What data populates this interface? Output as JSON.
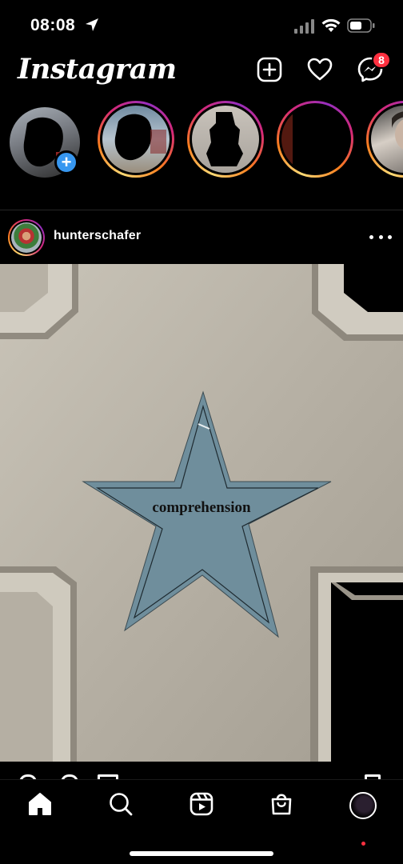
{
  "status_bar": {
    "time": "08:08",
    "icons": [
      "location-arrow-icon",
      "cellular-signal-icon",
      "wifi-icon",
      "battery-icon"
    ]
  },
  "header": {
    "app_name": "Instagram",
    "buttons": [
      "new-post-icon",
      "heart-icon",
      "messenger-icon"
    ],
    "messenger_badge": "8"
  },
  "stories": {
    "items": [
      {
        "kind": "your-story",
        "has_add_badge": true
      },
      {
        "kind": "story",
        "seen": false
      },
      {
        "kind": "story",
        "seen": false
      },
      {
        "kind": "story",
        "seen": false
      },
      {
        "kind": "story",
        "seen": false
      }
    ]
  },
  "post": {
    "username": "hunterschafer",
    "image_text": "comprehension",
    "menu_icon": "more-horizontal-icon"
  },
  "bottom_nav": {
    "items": [
      "home-icon",
      "search-icon",
      "reels-icon",
      "shop-icon",
      "profile-icon"
    ],
    "active": "home-icon"
  },
  "colors": {
    "background": "#000000",
    "story_gradient": [
      "#feda75",
      "#fa7e1e",
      "#d62976",
      "#962fbf"
    ],
    "badge": "#ff3040",
    "add_story": "#3797f0",
    "star": "#6f8e9c"
  }
}
